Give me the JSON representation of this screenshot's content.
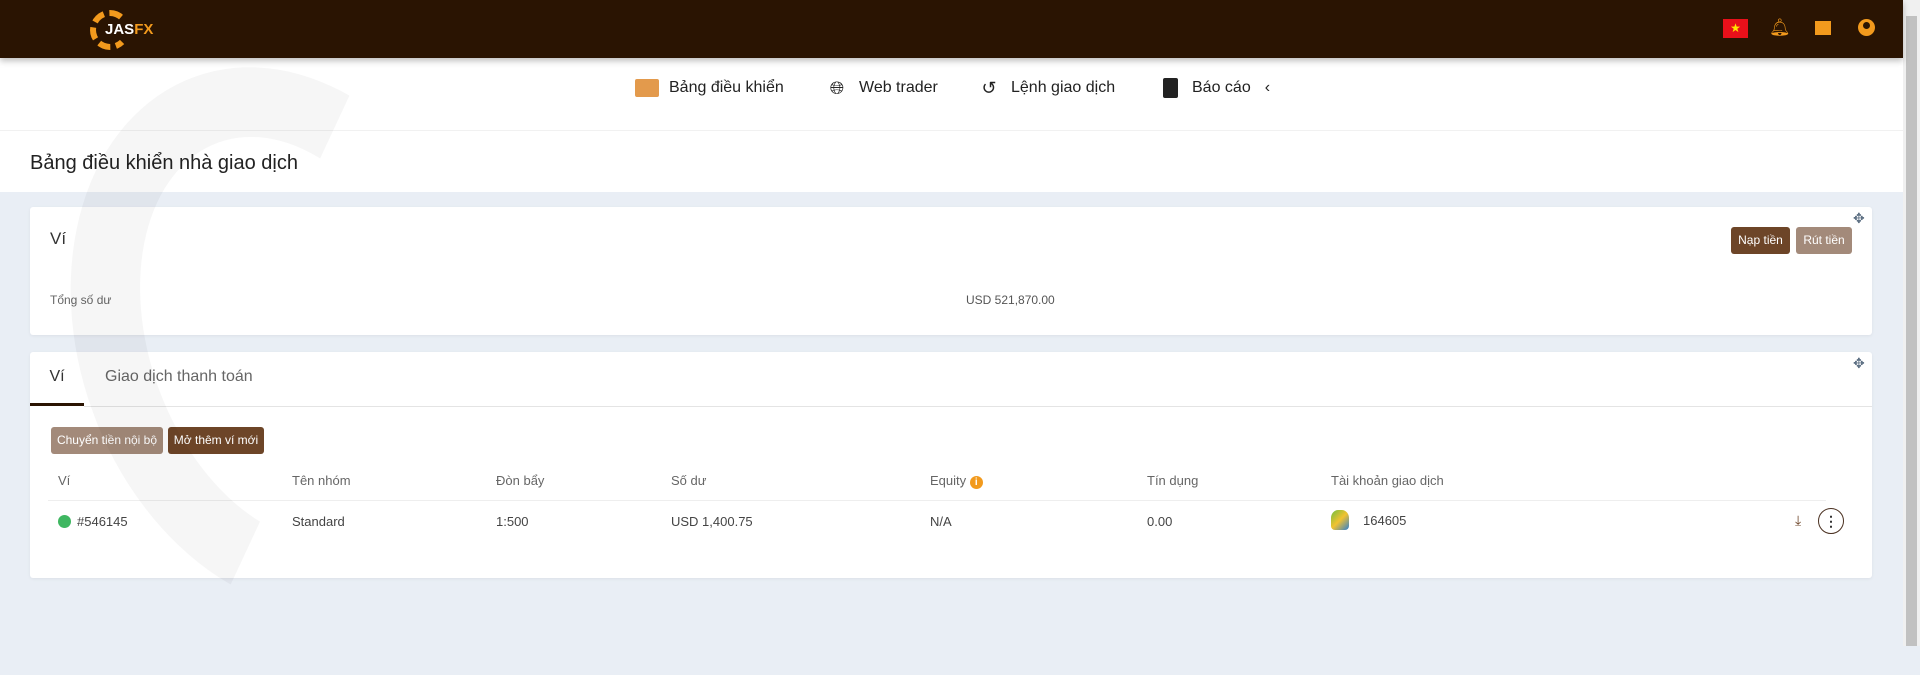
{
  "header": {
    "logo_text_a": "JAS",
    "logo_text_b": "FX",
    "flag": "vietnam-flag",
    "icons": [
      "bell-icon",
      "chat-icon",
      "user-icon"
    ]
  },
  "nav": [
    {
      "label": "Bảng điều khiển",
      "icon": "id-card-icon"
    },
    {
      "label": "Web trader",
      "icon": "globe-icon"
    },
    {
      "label": "Lệnh giao dịch",
      "icon": "history-icon"
    },
    {
      "label": "Báo cáo",
      "icon": "report-icon"
    }
  ],
  "page_title": "Bảng điều khiển nhà giao dịch",
  "wallet_card": {
    "title": "Ví",
    "deposit": "Nạp tiền",
    "withdraw": "Rút tiền",
    "total_label": "Tổng số dư",
    "total_value": "USD 521,870.00"
  },
  "wallets": {
    "tabs": [
      "Ví",
      "Giao dịch thanh toán"
    ],
    "transfer_btn": "Chuyển tiền nội bộ",
    "new_wallet_btn": "Mở thêm ví mới",
    "columns": [
      "Ví",
      "Tên nhóm",
      "Đòn bẩy",
      "Số dư",
      "Equity",
      "Tín dụng",
      "Tài khoản giao dịch"
    ],
    "rows": [
      {
        "wallet": "#546145",
        "group": "Standard",
        "leverage": "1:500",
        "balance": "USD 1,400.75",
        "equity": "N/A",
        "credit": "0.00",
        "account": "164605"
      }
    ]
  },
  "colors": {
    "header": "#2a1402",
    "accent": "#f29a1d",
    "btn_dark": "#6d4528",
    "btn_light": "#a38a7a"
  }
}
